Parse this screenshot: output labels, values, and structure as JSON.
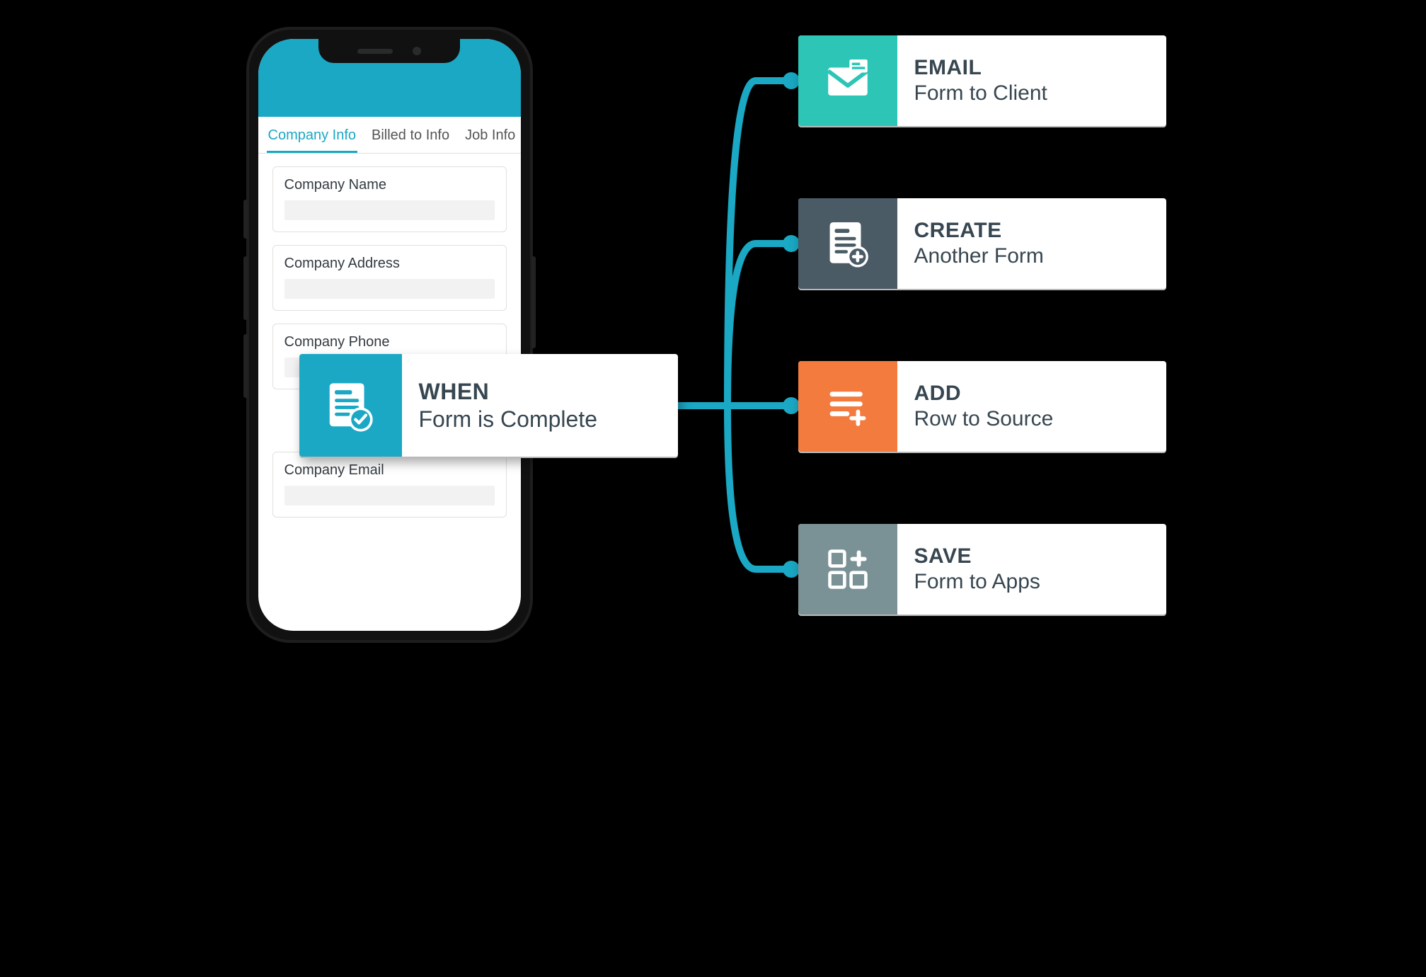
{
  "phone": {
    "tabs": [
      {
        "label": "Company Info",
        "active": true
      },
      {
        "label": "Billed to Info",
        "active": false
      },
      {
        "label": "Job Info",
        "active": false
      }
    ],
    "fields": [
      {
        "label": "Company Name"
      },
      {
        "label": "Company Address"
      },
      {
        "label": "Company Phone"
      },
      {
        "label": "Company Email"
      }
    ]
  },
  "trigger": {
    "title": "WHEN",
    "subtitle": "Form is Complete",
    "icon": "form-check-icon",
    "color": "#1aa8c4"
  },
  "actions": [
    {
      "key": "email",
      "title": "EMAIL",
      "subtitle": "Form to Client",
      "icon": "envelope-icon",
      "color": "#2cc5b6"
    },
    {
      "key": "create",
      "title": "CREATE",
      "subtitle": "Another Form",
      "icon": "form-plus-icon",
      "color": "#4a5b66"
    },
    {
      "key": "add",
      "title": "ADD",
      "subtitle": "Row to Source",
      "icon": "rows-plus-icon",
      "color": "#f47b3e"
    },
    {
      "key": "save",
      "title": "SAVE",
      "subtitle": "Form to Apps",
      "icon": "apps-plus-icon",
      "color": "#7a9196"
    }
  ]
}
